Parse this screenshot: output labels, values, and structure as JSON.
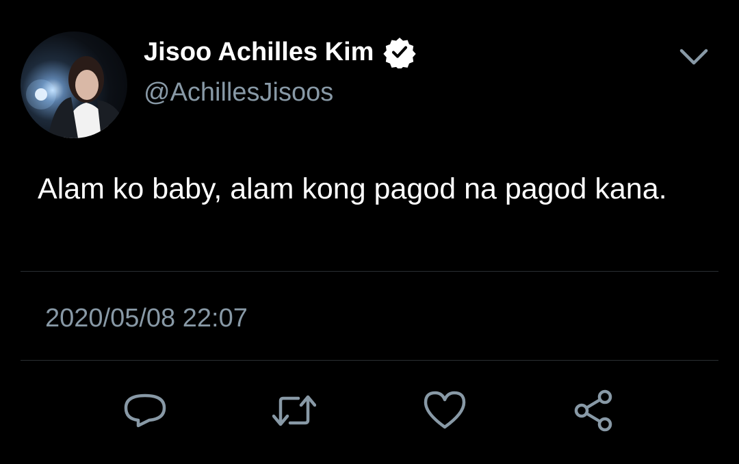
{
  "tweet": {
    "author": {
      "display_name": "Jisoo Achilles Kim",
      "handle": "@AchillesJisoos",
      "verified": true
    },
    "text": "Alam ko baby, alam kong pagod na pagod kana.",
    "timestamp": "2020/05/08 22:07"
  },
  "icons": {
    "more": "chevron-down-icon",
    "verified": "verified-badge-icon",
    "reply": "reply-icon",
    "retweet": "retweet-icon",
    "like": "heart-icon",
    "share": "share-icon"
  },
  "colors": {
    "background": "#000000",
    "primary_text": "#ffffff",
    "secondary_text": "#8899a6",
    "divider": "#2a2f33"
  }
}
